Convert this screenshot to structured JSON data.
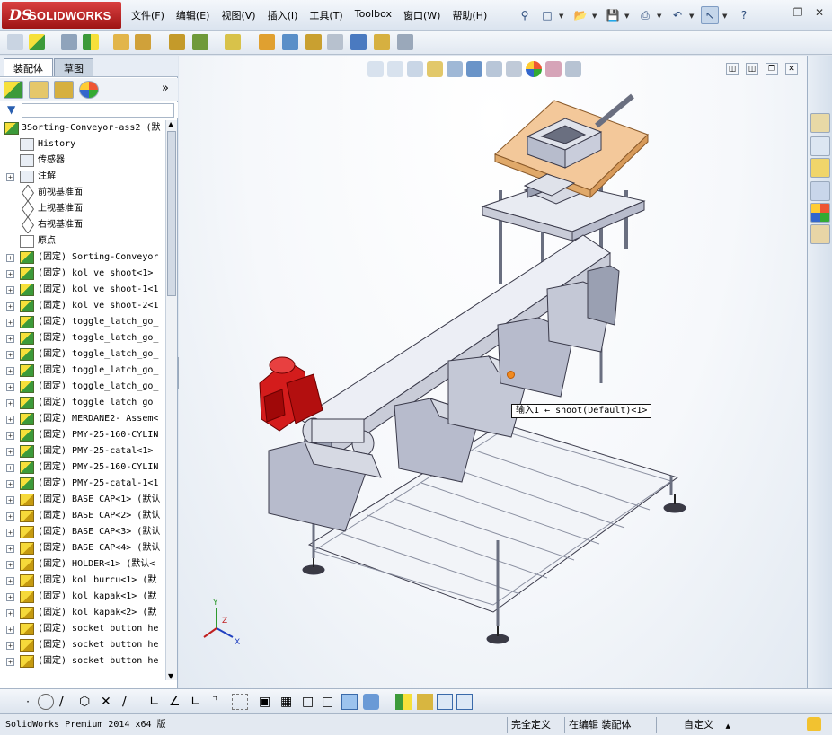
{
  "app": {
    "logo_ds": "DS",
    "logo_text": "SOLIDWORKS"
  },
  "menu": {
    "items": [
      {
        "label": "文件(F)"
      },
      {
        "label": "编辑(E)"
      },
      {
        "label": "视图(V)"
      },
      {
        "label": "插入(I)"
      },
      {
        "label": "工具(T)"
      },
      {
        "label": "Toolbox"
      },
      {
        "label": "窗口(W)"
      },
      {
        "label": "帮助(H)"
      }
    ]
  },
  "panel": {
    "tabs": [
      {
        "label": "装配体"
      },
      {
        "label": "草图"
      }
    ],
    "expand_glyph": "»"
  },
  "tree": {
    "root": "3Sorting-Conveyor-ass2 (默",
    "items": [
      {
        "label": "History",
        "icon": "history-icon",
        "expand": ""
      },
      {
        "label": "传感器",
        "icon": "sensor-icon",
        "expand": ""
      },
      {
        "label": "注解",
        "icon": "annotation-icon",
        "expand": "+"
      },
      {
        "label": "前视基准面",
        "icon": "plane-icon",
        "expand": ""
      },
      {
        "label": "上视基准面",
        "icon": "plane-icon",
        "expand": ""
      },
      {
        "label": "右视基准面",
        "icon": "plane-icon",
        "expand": ""
      },
      {
        "label": "原点",
        "icon": "origin-icon",
        "expand": ""
      },
      {
        "label": "(固定) Sorting-Conveyor",
        "icon": "assembly-icon",
        "expand": "+"
      },
      {
        "label": "(固定) kol ve shoot<1>",
        "icon": "assembly-icon",
        "expand": "+"
      },
      {
        "label": "(固定) kol ve shoot-1<1",
        "icon": "assembly-icon",
        "expand": "+"
      },
      {
        "label": "(固定) kol ve shoot-2<1",
        "icon": "assembly-icon",
        "expand": "+"
      },
      {
        "label": "(固定) toggle_latch_go_",
        "icon": "assembly-icon",
        "expand": "+"
      },
      {
        "label": "(固定) toggle_latch_go_",
        "icon": "assembly-icon",
        "expand": "+"
      },
      {
        "label": "(固定) toggle_latch_go_",
        "icon": "assembly-icon",
        "expand": "+"
      },
      {
        "label": "(固定) toggle_latch_go_",
        "icon": "assembly-icon",
        "expand": "+"
      },
      {
        "label": "(固定) toggle_latch_go_",
        "icon": "assembly-icon",
        "expand": "+"
      },
      {
        "label": "(固定) toggle_latch_go_",
        "icon": "assembly-icon",
        "expand": "+"
      },
      {
        "label": "(固定) MERDANE2- Assem<",
        "icon": "assembly-icon",
        "expand": "+"
      },
      {
        "label": "(固定) PMY-25-160-CYLIN",
        "icon": "assembly-icon",
        "expand": "+"
      },
      {
        "label": "(固定) PMY-25-catal<1>",
        "icon": "assembly-icon",
        "expand": "+"
      },
      {
        "label": "(固定) PMY-25-160-CYLIN",
        "icon": "assembly-icon",
        "expand": "+"
      },
      {
        "label": "(固定) PMY-25-catal-1<1",
        "icon": "assembly-icon",
        "expand": "+"
      },
      {
        "label": "(固定) BASE CAP<1> (默认",
        "icon": "part-icon",
        "expand": "+"
      },
      {
        "label": "(固定) BASE CAP<2> (默认",
        "icon": "part-icon",
        "expand": "+"
      },
      {
        "label": "(固定) BASE CAP<3> (默认",
        "icon": "part-icon",
        "expand": "+"
      },
      {
        "label": "(固定) BASE CAP<4> (默认",
        "icon": "part-icon",
        "expand": "+"
      },
      {
        "label": "(固定) HOLDER<1> (默认<",
        "icon": "part-icon",
        "expand": "+"
      },
      {
        "label": "(固定) kol burcu<1> (默",
        "icon": "part-icon",
        "expand": "+"
      },
      {
        "label": "(固定) kol kapak<1> (默",
        "icon": "part-icon",
        "expand": "+"
      },
      {
        "label": "(固定) kol kapak<2> (默",
        "icon": "part-icon",
        "expand": "+"
      },
      {
        "label": "(固定) socket button he",
        "icon": "part-icon",
        "expand": "+"
      },
      {
        "label": "(固定) socket button he",
        "icon": "part-icon",
        "expand": "+"
      },
      {
        "label": "(固定) socket button he",
        "icon": "part-icon",
        "expand": "+"
      }
    ]
  },
  "graphics": {
    "tooltip": "输入1 ← shoot(Default)<1>",
    "colors": {
      "motor": "#d41c1c",
      "wood": "#f3c89a",
      "metal": "#c9ccd8",
      "frame": "#e8ebf2",
      "outline": "#3a3a4a"
    },
    "triad_labels": [
      "Y",
      "Z",
      "X"
    ]
  },
  "status": {
    "version": "SolidWorks Premium 2014 x64 版",
    "constraint": "完全定义",
    "editing": "在编辑 装配体",
    "units": "自定义"
  }
}
